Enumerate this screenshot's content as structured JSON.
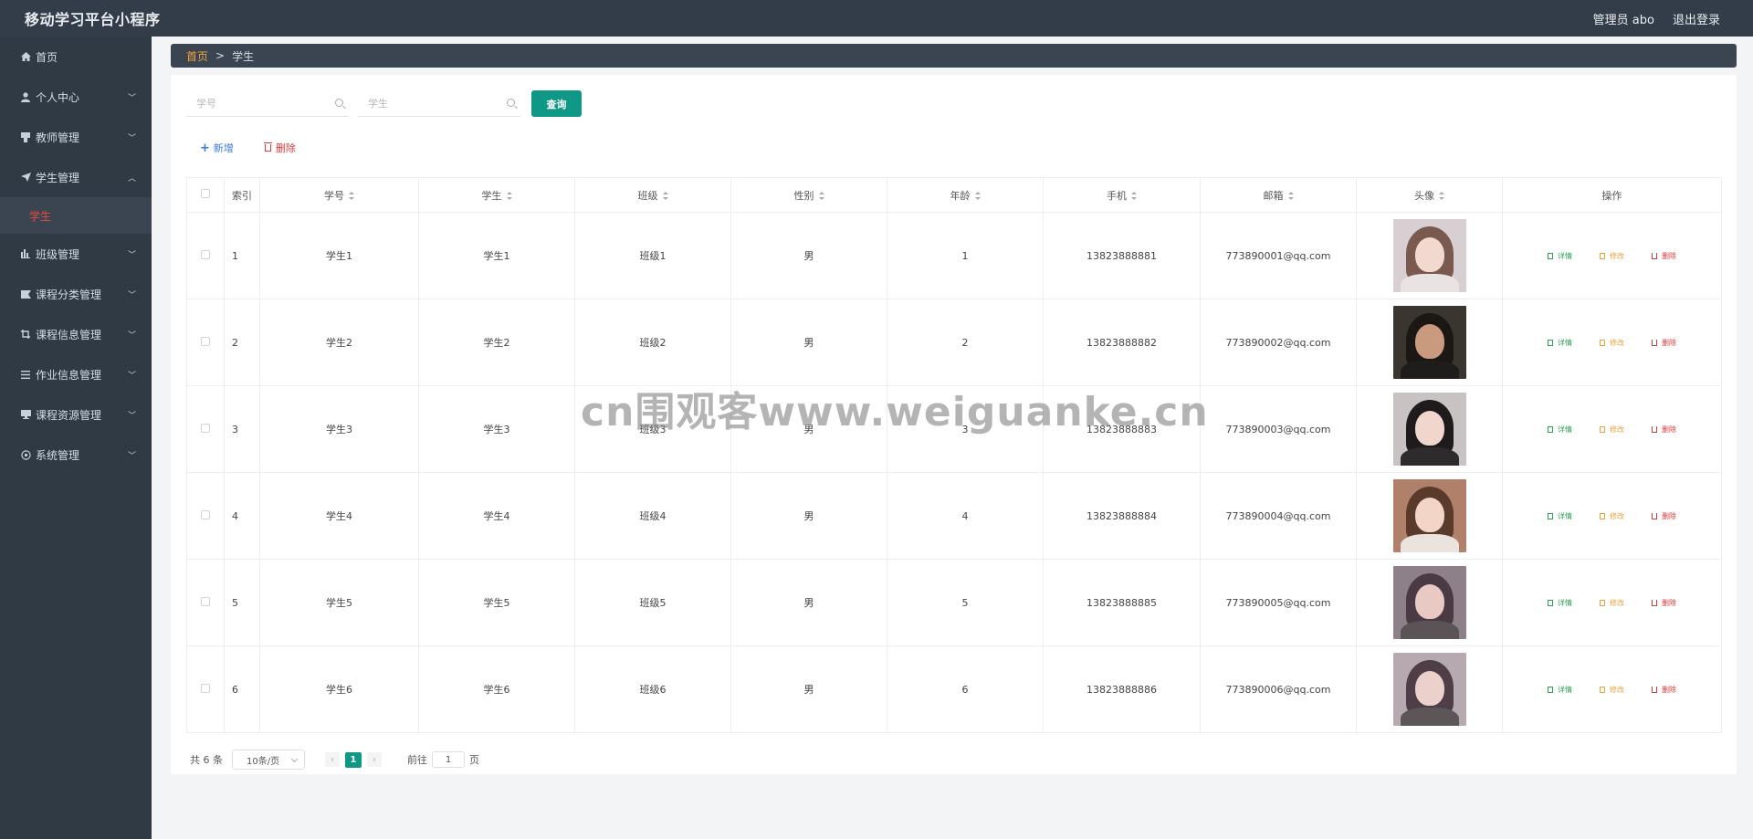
{
  "header": {
    "title": "移动学习平台小程序",
    "admin_label": "管理员 abo",
    "logout_label": "退出登录"
  },
  "sidebar": {
    "items": [
      {
        "label": "首页",
        "icon": "home-icon",
        "chevron": ""
      },
      {
        "label": "个人中心",
        "icon": "user-icon",
        "chevron": "﹀"
      },
      {
        "label": "教师管理",
        "icon": "teacher-icon",
        "chevron": "﹀"
      },
      {
        "label": "学生管理",
        "icon": "send-icon",
        "chevron": "︿"
      },
      {
        "label": "班级管理",
        "icon": "chart-icon",
        "chevron": "﹀"
      },
      {
        "label": "课程分类管理",
        "icon": "tag-icon",
        "chevron": "﹀"
      },
      {
        "label": "课程信息管理",
        "icon": "crop-icon",
        "chevron": "﹀"
      },
      {
        "label": "作业信息管理",
        "icon": "list-icon",
        "chevron": "﹀"
      },
      {
        "label": "课程资源管理",
        "icon": "monitor-icon",
        "chevron": "﹀"
      },
      {
        "label": "系统管理",
        "icon": "settings-icon",
        "chevron": "﹀"
      }
    ],
    "active_sub": "学生"
  },
  "breadcrumb": {
    "home": "首页",
    "sep": ">",
    "current": "学生"
  },
  "search": {
    "student_no_placeholder": "学号",
    "student_name_placeholder": "学生",
    "query_label": "查询"
  },
  "actions": {
    "add_label": "新增",
    "delete_label": "删除"
  },
  "table": {
    "headers": [
      "索引",
      "学号",
      "学生",
      "班级",
      "性别",
      "年龄",
      "手机",
      "邮箱",
      "头像",
      "操作"
    ],
    "rows": [
      {
        "index": "1",
        "no": "学生1",
        "name": "学生1",
        "class": "班级1",
        "gender": "男",
        "age": "1",
        "phone": "13823888881",
        "email": "773890001@qq.com"
      },
      {
        "index": "2",
        "no": "学生2",
        "name": "学生2",
        "class": "班级2",
        "gender": "男",
        "age": "2",
        "phone": "13823888882",
        "email": "773890002@qq.com"
      },
      {
        "index": "3",
        "no": "学生3",
        "name": "学生3",
        "class": "班级3",
        "gender": "男",
        "age": "3",
        "phone": "13823888883",
        "email": "773890003@qq.com"
      },
      {
        "index": "4",
        "no": "学生4",
        "name": "学生4",
        "class": "班级4",
        "gender": "男",
        "age": "4",
        "phone": "13823888884",
        "email": "773890004@qq.com"
      },
      {
        "index": "5",
        "no": "学生5",
        "name": "学生5",
        "class": "班级5",
        "gender": "男",
        "age": "5",
        "phone": "13823888885",
        "email": "773890005@qq.com"
      },
      {
        "index": "6",
        "no": "学生6",
        "name": "学生6",
        "class": "班级6",
        "gender": "男",
        "age": "6",
        "phone": "13823888886",
        "email": "773890006@qq.com"
      }
    ],
    "ops": {
      "detail": "详情",
      "edit": "修改",
      "delete": "删除"
    }
  },
  "pagination": {
    "total": "共 6 条",
    "page_size": "10条/页",
    "current_page": "1",
    "goto_prefix": "前往",
    "goto_value": "1",
    "goto_suffix": "页",
    "prev": "‹",
    "next": "›"
  },
  "watermark": "cn围观客www.weiguanke.cn",
  "colors": {
    "topbar": "#333d49",
    "sidebar": "#303a45",
    "accent": "#109887",
    "active_sub": "#e64b3c",
    "breadcrumb_home": "#f0a43b"
  }
}
